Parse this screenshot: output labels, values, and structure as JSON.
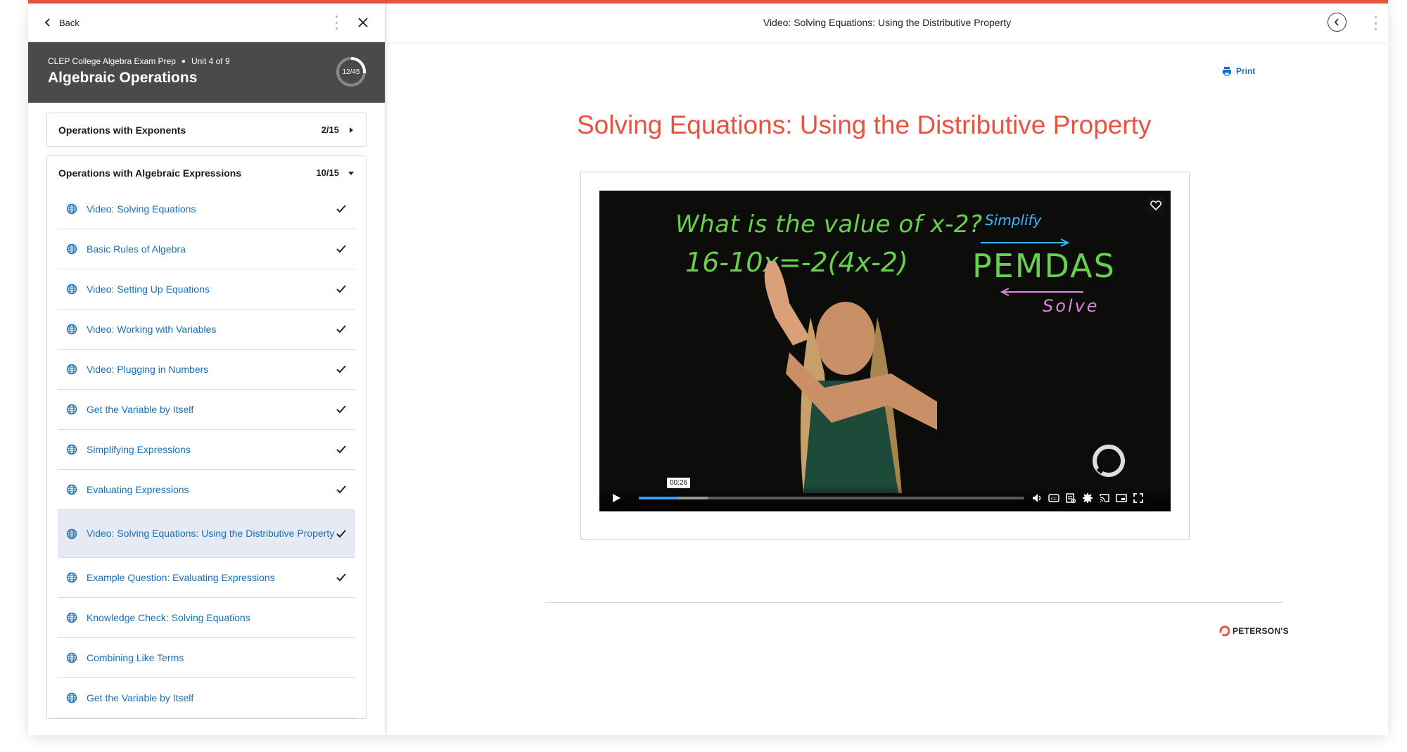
{
  "colors": {
    "accent": "#e8543f",
    "link": "#1a6fb8",
    "header_bg": "#4a4a4a",
    "active_row": "#e6ebf3"
  },
  "sidebar": {
    "back_label": "Back",
    "course": "CLEP College Algebra Exam Prep",
    "unit": "Unit 4 of 9",
    "unit_title": "Algebraic Operations",
    "progress_text": "12/45",
    "progress_fraction": 0.267,
    "sections": [
      {
        "name": "Operations with Exponents",
        "count": "2/15",
        "expanded": false
      },
      {
        "name": "Operations with Algebraic Expressions",
        "count": "10/15",
        "expanded": true
      }
    ],
    "lessons": [
      {
        "label": "Video: Solving Equations",
        "completed": true
      },
      {
        "label": "Basic Rules of Algebra",
        "completed": true
      },
      {
        "label": "Video: Setting Up Equations",
        "completed": true
      },
      {
        "label": "Video: Working with Variables",
        "completed": true
      },
      {
        "label": "Video: Plugging in Numbers",
        "completed": true
      },
      {
        "label": "Get the Variable by Itself",
        "completed": true
      },
      {
        "label": "Simplifying Expressions",
        "completed": true
      },
      {
        "label": "Evaluating Expressions",
        "completed": true
      },
      {
        "label": "Video: Solving Equations: Using the Distributive Property",
        "completed": true,
        "active": true
      },
      {
        "label": "Example Question: Evaluating Expressions",
        "completed": true
      },
      {
        "label": "Knowledge Check: Solving Equations",
        "completed": false
      },
      {
        "label": "Combining Like Terms",
        "completed": false
      },
      {
        "label": "Get the Variable by Itself",
        "completed": false
      }
    ]
  },
  "topbar": {
    "title": "Video: Solving Equations: Using the Distributive Property"
  },
  "main": {
    "print_label": "Print",
    "title": "Solving Equations: Using the Distributive Property",
    "brand": "PETERSON'S"
  },
  "video": {
    "board_line1": "What is the value of x-2?",
    "board_line2": "16-10x=-2(4x-2)",
    "board_simplify": "Simplify",
    "board_pemdas": "PEMDAS",
    "board_solve": "Solve",
    "current_time": "00:26",
    "played_fraction": 0.1,
    "buffered_fraction": 0.18
  }
}
